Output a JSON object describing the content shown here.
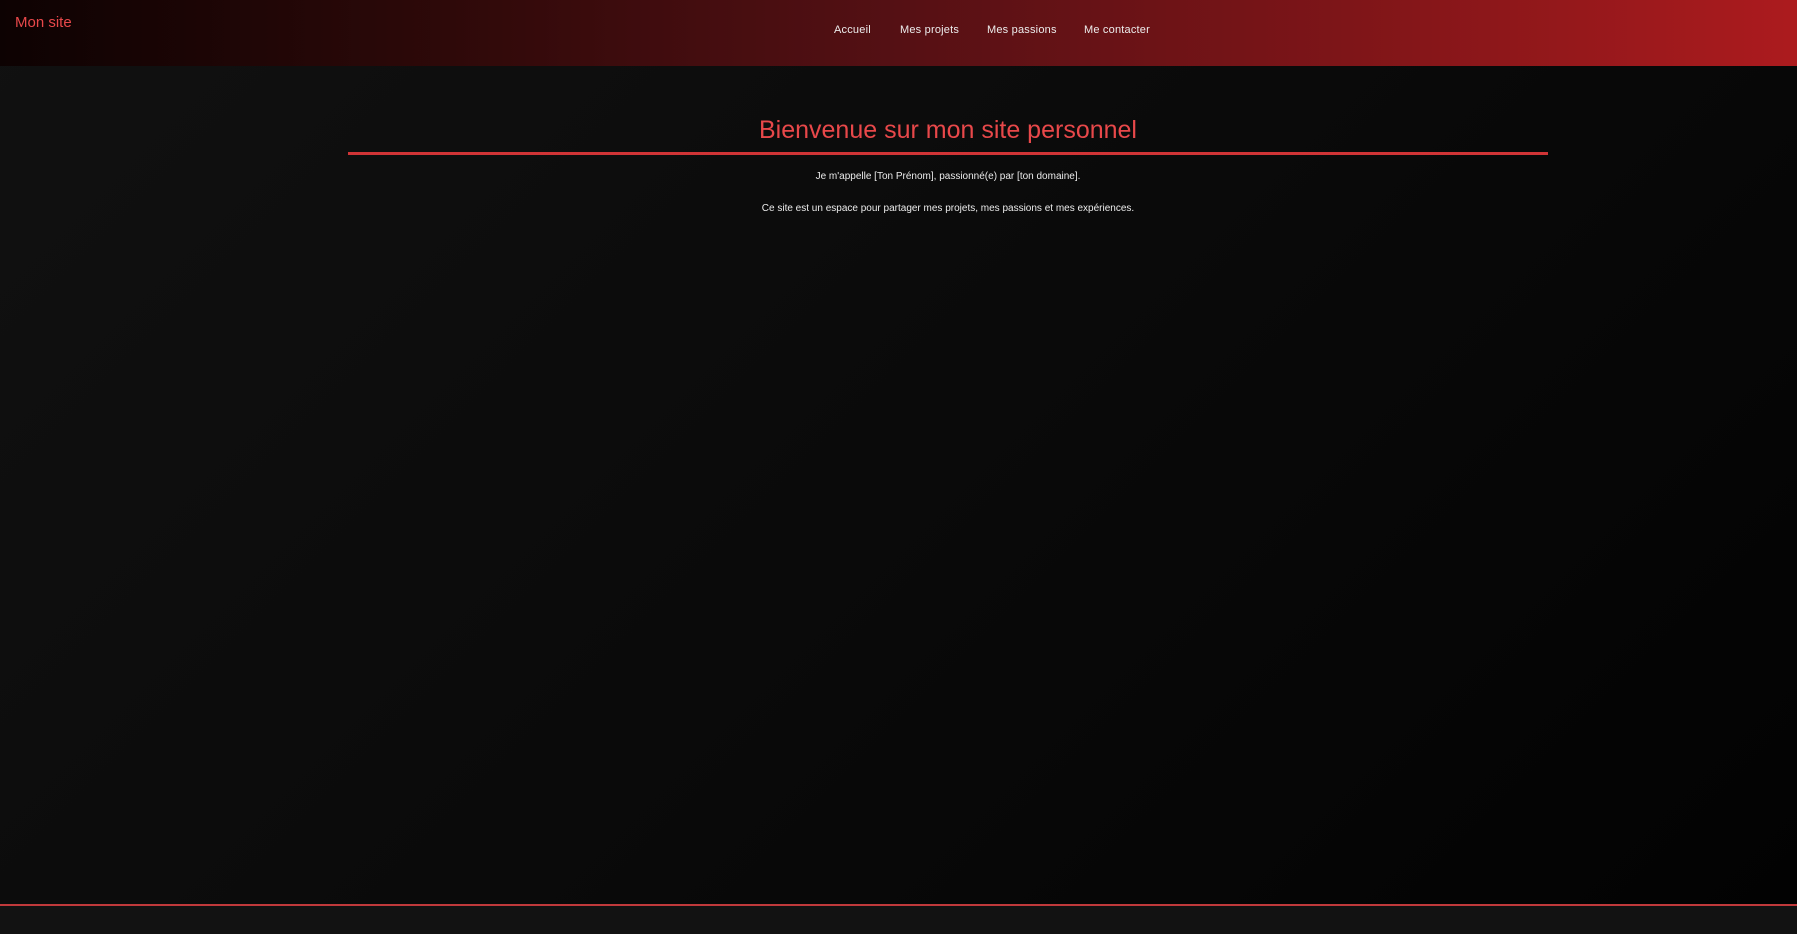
{
  "header": {
    "logo": "Mon site",
    "nav": [
      {
        "label": "Accueil"
      },
      {
        "label": "Mes projets"
      },
      {
        "label": "Mes passions"
      },
      {
        "label": "Me contacter"
      }
    ]
  },
  "main": {
    "title": "Bienvenue sur mon site personnel",
    "paragraphs": [
      "Je m'appelle [Ton Prénom], passionné(e) par [ton domaine].",
      "Ce site est un espace pour partager mes projets, mes passions et mes expériences."
    ]
  },
  "colors": {
    "accent": "#e8484a",
    "rule": "#d03436",
    "header_start": "#0d0202",
    "header_end": "#ac1b1e",
    "background": "#0a0a0a"
  }
}
